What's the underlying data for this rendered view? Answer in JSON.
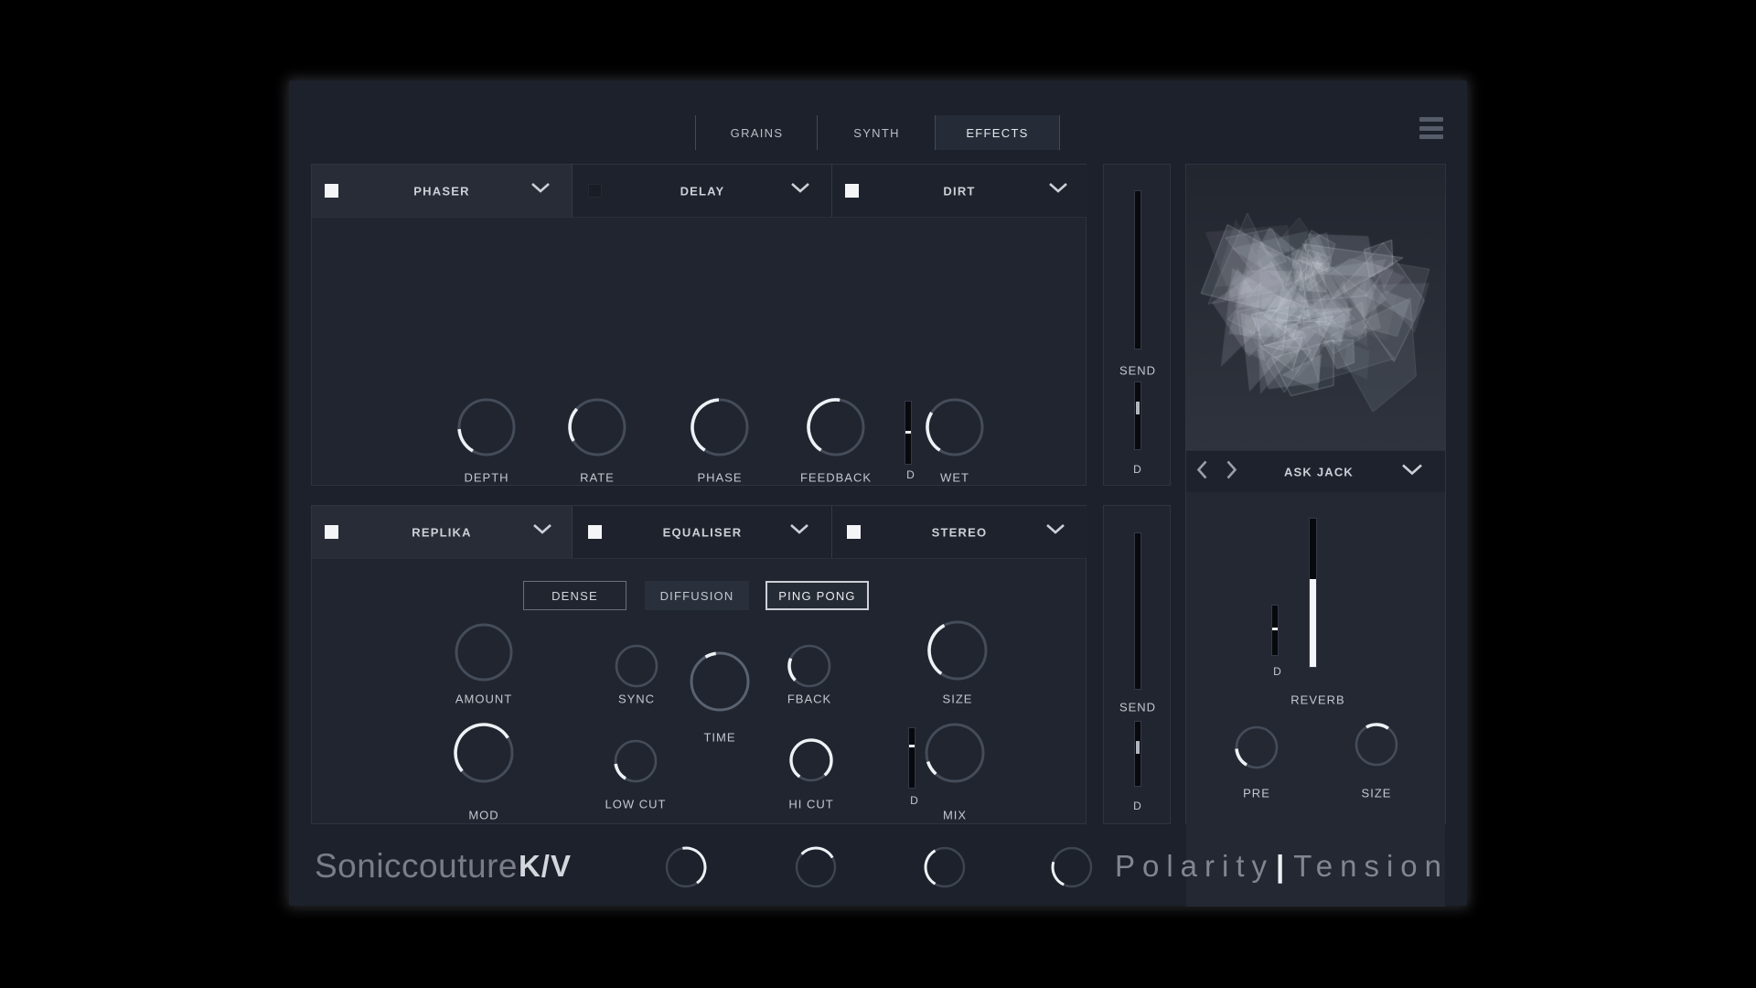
{
  "tabs": {
    "grains": "GRAINS",
    "synth": "SYNTH",
    "effects": "EFFECTS"
  },
  "fx_top": {
    "phaser": {
      "label": "PHASER",
      "enabled": true
    },
    "delay": {
      "label": "DELAY",
      "enabled": false
    },
    "dirt": {
      "label": "DIRT",
      "enabled": true
    },
    "knobs": {
      "depth": {
        "label": "DEPTH",
        "arc": [
          210,
          266
        ]
      },
      "rate": {
        "label": "RATE",
        "arc": [
          240,
          312
        ]
      },
      "phase": {
        "label": "PHASE",
        "arc": [
          213,
          358
        ]
      },
      "feedback": {
        "label": "FEEDBACK",
        "arc": [
          213,
          368
        ]
      },
      "wet": {
        "label": "WET",
        "arc": [
          213,
          302
        ]
      }
    },
    "drive": {
      "label": "D",
      "tick": 0.49
    }
  },
  "send_top": {
    "label": "SEND",
    "fader_fill": 0,
    "d": {
      "label": "D",
      "tick": 0.38
    }
  },
  "fx_bottom": {
    "replika": {
      "label": "REPLIKA",
      "enabled": true
    },
    "equaliser": {
      "label": "EQUALISER",
      "enabled": true
    },
    "stereo": {
      "label": "STEREO",
      "enabled": true
    },
    "buttons": {
      "dense": {
        "label": "DENSE"
      },
      "diffusion": {
        "label": "DIFFUSION"
      },
      "pingpong": {
        "label": "PING PONG"
      }
    },
    "knobs": {
      "amount": {
        "label": "AMOUNT",
        "arc": null
      },
      "sync": {
        "label": "SYNC",
        "arc": null
      },
      "time": {
        "label": "TIME",
        "arc": [
          330,
          352
        ]
      },
      "fback": {
        "label": "FBACK",
        "arc": [
          225,
          292
        ]
      },
      "size": {
        "label": "SIZE",
        "arc": [
          215,
          332
        ]
      },
      "mod": {
        "label": "MOD",
        "arc": [
          230,
          418
        ]
      },
      "lowcut": {
        "label": "LOW CUT",
        "arc": [
          210,
          262
        ]
      },
      "hicut": {
        "label": "HI CUT",
        "arc": [
          215,
          498
        ]
      },
      "mix": {
        "label": "MIX",
        "arc": [
          222,
          252
        ]
      }
    },
    "mix_d": {
      "label": "D",
      "tick": 0.3
    }
  },
  "send_bottom": {
    "label": "SEND",
    "fader_fill": 0,
    "d": {
      "label": "D",
      "tick": 0.4
    }
  },
  "right_panel": {
    "preset": {
      "label": "ASK JACK"
    },
    "reverb": {
      "label": "REVERB",
      "fader_fill": 0.59,
      "d": {
        "label": "D",
        "tick": 0.47
      },
      "pre": {
        "label": "PRE",
        "arc": [
          210,
          266
        ]
      },
      "size": {
        "label": "SIZE",
        "arc": [
          330,
          396
        ]
      }
    }
  },
  "footer": {
    "brand": "Soniccouture",
    "product": "K/V",
    "title_left": "Polarity",
    "title_sep": "|",
    "title_right": "Tension",
    "knobs": {
      "k1": {
        "arc": [
          350,
          505
        ]
      },
      "k2": {
        "arc": [
          313,
          420
        ]
      },
      "k3": {
        "arc": [
          210,
          330
        ]
      },
      "k4": {
        "arc": [
          205,
          286
        ]
      }
    }
  },
  "colors": {
    "arc_white": "#eef1f5",
    "ring_grey": "#454c59",
    "ring_light": "#5a6270",
    "ring_footer": "#3e4551"
  }
}
